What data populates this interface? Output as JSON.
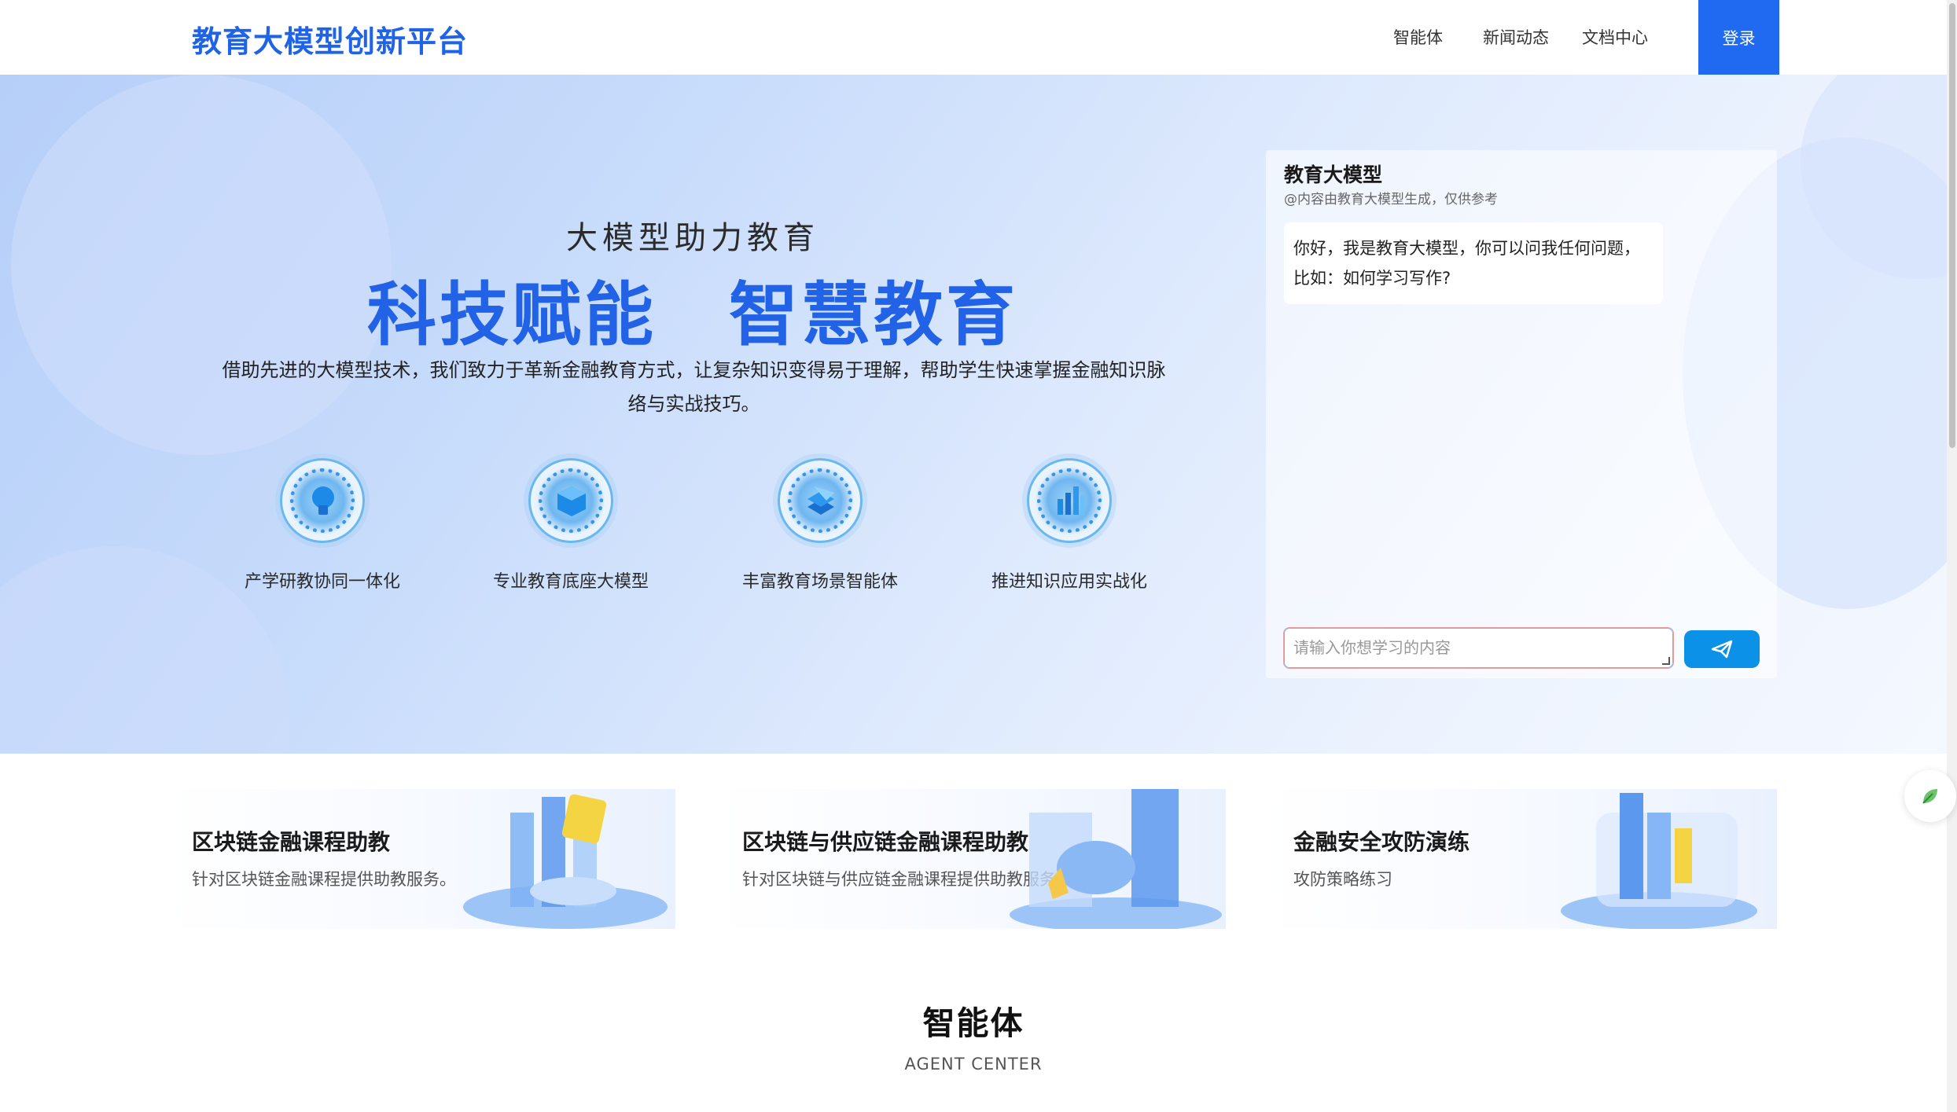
{
  "header": {
    "logo": "教育大模型创新平台",
    "nav": [
      "智能体",
      "新闻动态",
      "文档中心"
    ],
    "login": "登录"
  },
  "hero": {
    "subtitle": "大模型助力教育",
    "title": "科技赋能　智慧教育",
    "description": "借助先进的大模型技术，我们致力于革新金融教育方式，让复杂知识变得易于理解，帮助学生快速掌握金融知识脉络与实战技巧。",
    "features": [
      {
        "label": "产学研教协同一体化",
        "icon": "brain-icon"
      },
      {
        "label": "专业教育底座大模型",
        "icon": "cube-icon"
      },
      {
        "label": "丰富教育场景智能体",
        "icon": "layers-icon"
      },
      {
        "label": "推进知识应用实战化",
        "icon": "bar-chart-icon"
      }
    ]
  },
  "chat": {
    "title": "教育大模型",
    "note": "@内容由教育大模型生成，仅供参考",
    "greeting": "你好，我是教育大模型，你可以问我任何问题，比如：如何学习写作?",
    "input_placeholder": "请输入你想学习的内容",
    "send_icon": "paper-plane-icon"
  },
  "courses": [
    {
      "title": "区块链金融课程助教",
      "desc": "针对区块链金融课程提供助教服务。"
    },
    {
      "title": "区块链与供应链金融课程助教",
      "desc": "针对区块链与供应链金融课程提供助教服务。"
    },
    {
      "title": "金融安全攻防演练",
      "desc": "攻防策略练习"
    }
  ],
  "section": {
    "title": "智能体",
    "subtitle": "AGENT CENTER"
  },
  "colors": {
    "brand": "#1f63e6",
    "login_bg": "#1f6af0",
    "send_bg": "#0b91e8"
  }
}
